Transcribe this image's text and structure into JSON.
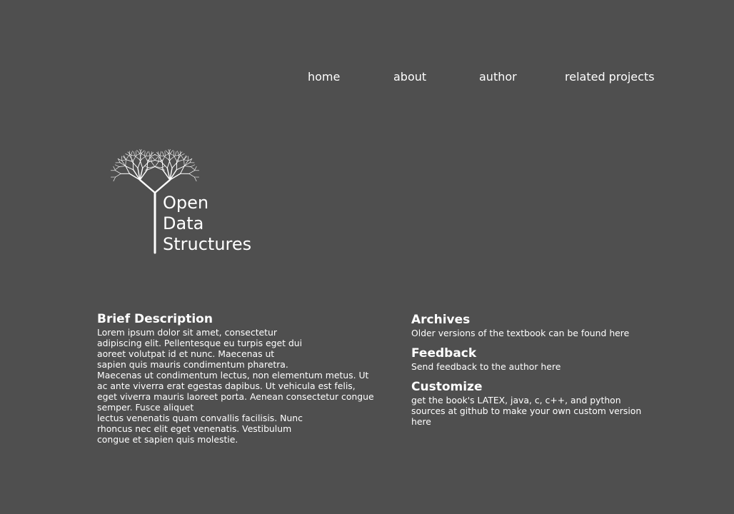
{
  "nav": {
    "items": [
      {
        "label": "home"
      },
      {
        "label": "about"
      },
      {
        "label": "author"
      },
      {
        "label": "related projects"
      }
    ]
  },
  "logo": {
    "lines": [
      "Open",
      "Data",
      "Structures"
    ]
  },
  "description": {
    "heading": "Brief Description",
    "lines": [
      "Lorem ipsum dolor sit amet, consectetur",
      "adipiscing elit. Pellentesque eu turpis eget dui",
      "aoreet volutpat id et nunc. Maecenas ut",
      "sapien quis mauris condimentum pharetra.",
      "Maecenas ut condimentum lectus, non elementum metus. Ut",
      "ac ante viverra erat egestas dapibus. Ut vehicula est felis,",
      "eget viverra mauris laoreet porta. Aenean consectetur congue",
      "semper. Fusce aliquet",
      "lectus venenatis quam convallis facilisis. Nunc",
      "rhoncus nec elit eget venenatis. Vestibulum",
      "congue et sapien quis molestie."
    ]
  },
  "sidebar": {
    "archives": {
      "heading": "Archives",
      "text": "Older versions of the textbook can be found here"
    },
    "feedback": {
      "heading": "Feedback",
      "text": "Send feedback to the author here"
    },
    "customize": {
      "heading": "Customize",
      "lines": [
        "get the book's LATEX, java, c, c++, and python",
        "sources at github to make your own custom version",
        "here"
      ]
    }
  },
  "colors": {
    "background": "#4f4f4f",
    "text": "#ffffff"
  }
}
